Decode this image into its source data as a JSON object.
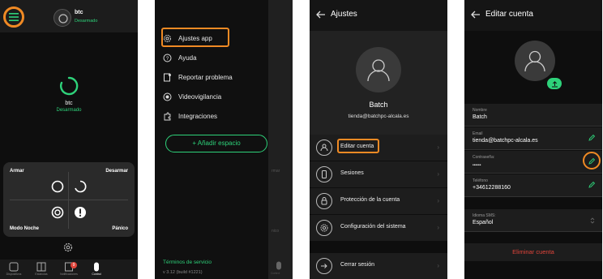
{
  "colors": {
    "accent": "#2ed27a",
    "highlight": "#f08a24",
    "danger": "#e0443a",
    "background": "#0e0e0e"
  },
  "screen_home": {
    "hub": {
      "name": "btc",
      "state": "Desarmado"
    },
    "status": {
      "name": "btc",
      "state": "Desarmado"
    },
    "controls": {
      "arm": "Armar",
      "disarm": "Desarmar",
      "night": "Modo Noche",
      "panic": "Pánico"
    },
    "nav": [
      "Dispositivos",
      "Estancias",
      "Notificaciones",
      "Control"
    ],
    "notification_count": "9"
  },
  "screen_menu": {
    "items": [
      {
        "label": "Ajustes app",
        "icon": "gear-icon"
      },
      {
        "label": "Ayuda",
        "icon": "help-icon"
      },
      {
        "label": "Reportar problema",
        "icon": "report-icon"
      },
      {
        "label": "Videovigilancia",
        "icon": "camera-icon"
      },
      {
        "label": "Integraciones",
        "icon": "puzzle-icon"
      }
    ],
    "add_space": "+ Añadir espacio",
    "terms": "Términos de servicio",
    "version": "v 3.12 (build #1221)",
    "behind": {
      "disarm_partial": "rmar",
      "panic_partial": "nico",
      "control": "Control"
    }
  },
  "screen_settings": {
    "title": "Ajustes",
    "user": {
      "name": "Batch",
      "email": "tienda@batchpc-alcala.es"
    },
    "rows": [
      {
        "label": "Editar cuenta",
        "icon": "user-icon"
      },
      {
        "label": "Sesiones",
        "icon": "phone-icon"
      },
      {
        "label": "Protección de la cuenta",
        "icon": "lock-icon"
      },
      {
        "label": "Configuración del sistema",
        "icon": "gear-icon"
      },
      {
        "label": "Cerrar sesión",
        "icon": "logout-icon"
      }
    ]
  },
  "screen_edit": {
    "title": "Editar cuenta",
    "fields": [
      {
        "label": "Nombre",
        "value": "Batch"
      },
      {
        "label": "Email",
        "value": "tienda@batchpc-alcala.es"
      },
      {
        "label": "Contraseña:",
        "value": "••••••"
      },
      {
        "label": "Teléfono",
        "value": "+34612288160"
      },
      {
        "label": "Idioma SMS:",
        "value": "Español"
      }
    ],
    "delete": "Eliminar cuenta"
  }
}
